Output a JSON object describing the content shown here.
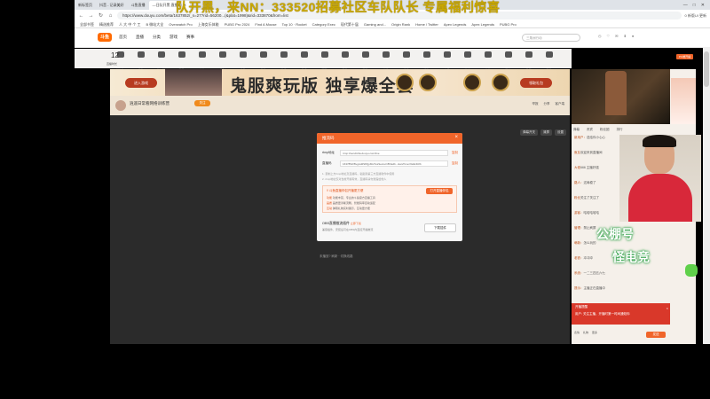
{
  "browser": {
    "tabs": [
      {
        "label": "新标签页"
      },
      {
        "label": "抖音 - 记录美好"
      },
      {
        "label": "斗鱼直播"
      },
      {
        "label": "—日队开黑 直播间",
        "active": true
      }
    ],
    "window_controls": [
      "—",
      "□",
      "✕"
    ],
    "url": "https://www.douyu.com/beta/1637852/_s=27?rid=56200...(&plat=1998)&rid=333870&from=list",
    "extensions": "0  新版UI  更新",
    "bookmarks": [
      "全部书签",
      "精选推荐",
      "人 大 中 个 工",
      "B 微站大全",
      "Overwatch Pro",
      "上海女乐体能",
      "PUBG Pro 2024",
      "Find A Mouse",
      "Top 10 · Rocket",
      "Category Exec",
      "现代第十届",
      "Gaming and...",
      "Origin Rank",
      "Home / Twitter",
      "Apex Legends",
      "Apex Legends",
      "PUBG Pro"
    ]
  },
  "marquee": "队开黑，来NN：333520招募社区车队队长 专属福利惊喜",
  "site": {
    "logo": "斗鱼",
    "nav": [
      "首页",
      "直播",
      "分类",
      "游戏",
      "赛事"
    ],
    "search_placeholder": "三角洲行动"
  },
  "toolbar": {
    "count": "12",
    "count_label": "直播时长",
    "items": [
      "送礼物",
      "任务",
      "粉丝团",
      "节目",
      "礼物",
      "福利",
      "红包",
      "宝箱",
      "壁纸",
      "贵族",
      "赛事",
      "更多",
      "竞猜",
      "抽奖",
      "排行",
      "活动",
      "充值",
      "商城",
      "分享",
      "回放",
      "录屏",
      "更多"
    ]
  },
  "banner": {
    "enter_label": "进入游戏",
    "title": "鬼服爽玩版 独享爆全套",
    "claim_label": "领取礼包"
  },
  "room": {
    "title": "逍遥日常看网络训练营",
    "tag": "关注",
    "actions": [
      "举报",
      "分享",
      "客户端"
    ]
  },
  "player": {
    "actions": [
      "弹幕开关",
      "清屏",
      "设置"
    ],
    "help_text": "未播放? 刷新 · 切换线路"
  },
  "modal": {
    "title": "推流码",
    "rtmp_label": "rtmp地址",
    "rtmp_value": "rtmp://sendtc3a.douyu.com/live",
    "key_label": "直播码",
    "key_value": "1637852rBvgAd2S8QpMs?wsSecret=8f3a2b...&wsTime=6a9c4f2b",
    "copy_label": "复制",
    "note1": "1. 复制上方rtmp地址及直播码，粘贴到第三方直播软件中使用",
    "note2": "2. rtmp地址仅对当前开播有效，直播码请勿泄露给他人",
    "tip_header": "!! 斗鱼直播伴侣开播更方便",
    "tip_btn": "打开直播伴侣",
    "tip_lines": [
      {
        "k": "功能",
        "v": "功能丰富、专业的斗鱼官方直播工具"
      },
      {
        "k": "画质",
        "v": "画质更清晰流畅，智能码率自动适配"
      },
      {
        "k": "互动",
        "v": "弹幕礼物实时展示，互动更方便"
      }
    ],
    "obs_title": "OBS直播推流插件",
    "obs_link": "立即下载",
    "obs_desc": "兼容插件，安装后可在OBS内直接开播推流",
    "download_label": "下载插件"
  },
  "right_panel": {
    "badge": "PC端开播",
    "tabs": [
      "弹幕",
      "贵宾",
      "粉丝团",
      "排行"
    ],
    "chat": [
      {
        "user": "新用户：",
        "text": "送给你小心心"
      },
      {
        "user": "鱼友",
        "text": "欢迎来到直播间"
      },
      {
        "user": "大佬",
        "text": "666 主播好强"
      },
      {
        "user": "路人：",
        "text": "这局稳了"
      },
      {
        "user": "粉丝",
        "text": "关注了关注了"
      },
      {
        "user": "游客：",
        "text": "哈哈哈哈哈"
      },
      {
        "user": "管理：",
        "text": "禁止刷屏"
      },
      {
        "user": "萌新：",
        "text": "怎么玩的"
      },
      {
        "user": "老铁：",
        "text": "冲冲冲"
      },
      {
        "user": "系统：",
        "text": "一二三四五六七"
      },
      {
        "user": "提示：",
        "text": "主播正在直播中"
      }
    ],
    "red_banner_title": "开播提醒",
    "red_banner_msg": "用户: 关注主播，开播时第一时间通知你",
    "footer": [
      "表情",
      "礼物",
      "更多"
    ],
    "send_label": "发送"
  },
  "cam": {
    "text1": "公棚号",
    "text2": "怪电竞"
  }
}
